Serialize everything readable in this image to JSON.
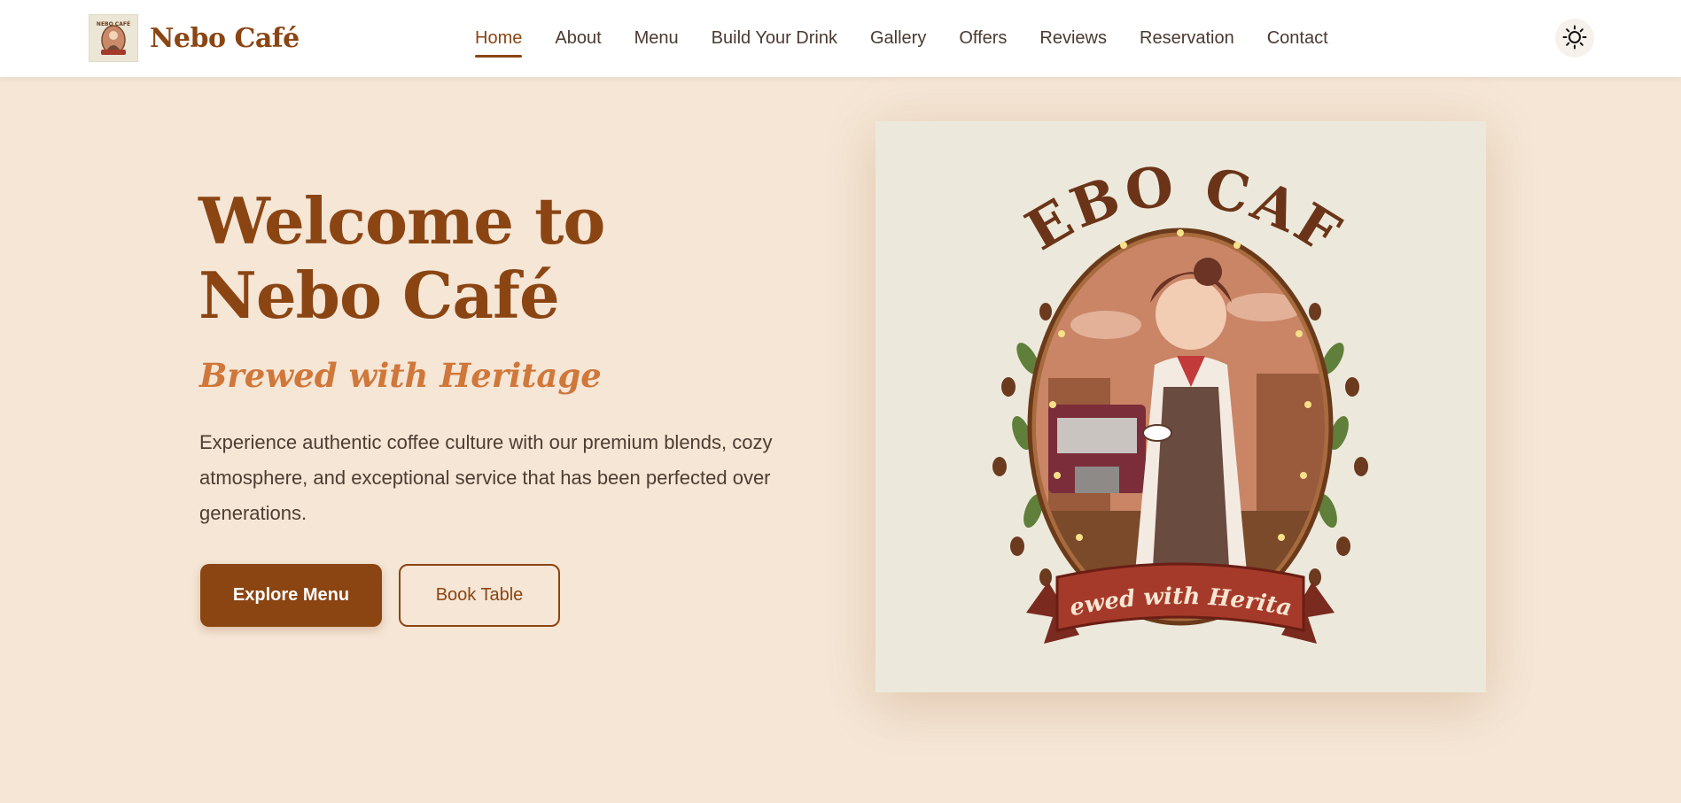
{
  "brand": {
    "name": "Nebo Café",
    "logo_icon": "cafe-logo-icon"
  },
  "nav": {
    "items": [
      {
        "label": "Home",
        "active": true
      },
      {
        "label": "About"
      },
      {
        "label": "Menu"
      },
      {
        "label": "Build Your Drink"
      },
      {
        "label": "Gallery"
      },
      {
        "label": "Offers"
      },
      {
        "label": "Reviews"
      },
      {
        "label": "Reservation"
      },
      {
        "label": "Contact"
      }
    ],
    "theme_toggle_icon": "sun-icon"
  },
  "hero": {
    "title": "Welcome to Nebo Café",
    "subtitle": "Brewed with Heritage",
    "description": "Experience authentic coffee culture with our premium blends, cozy atmosphere, and exceptional service that has been perfected over generations.",
    "primary_button": "Explore Menu",
    "secondary_button": "Book Table",
    "image": {
      "arc_text": "NEBO CAFÉ",
      "banner_text": "Brewed with Heritage"
    }
  },
  "colors": {
    "accent": "#8b4513",
    "subtitle": "#d0773a",
    "background": "#f5e6d6",
    "header": "#ffffff"
  }
}
